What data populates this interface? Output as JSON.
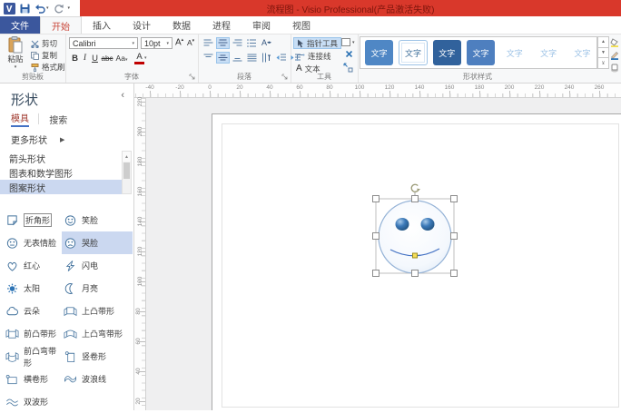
{
  "titlebar": {
    "title": "流程图 - Visio Professional(产品激活失败)",
    "quick_access_icons": [
      "visio-app-icon",
      "save-icon",
      "undo-icon",
      "redo-icon",
      "customize-qat-icon"
    ]
  },
  "tabs": {
    "file": "文件",
    "items": [
      "开始",
      "插入",
      "设计",
      "数据",
      "进程",
      "审阅",
      "视图"
    ],
    "selected": "开始"
  },
  "ribbon": {
    "clipboard": {
      "label": "剪贴板",
      "paste": "粘贴",
      "cut": "剪切",
      "copy": "复制",
      "format_painter": "格式刷"
    },
    "font": {
      "label": "字体",
      "family": "Calibri",
      "size": "10pt",
      "grow": "A",
      "shrink": "A",
      "bold": "B",
      "italic": "I",
      "underline": "U",
      "strike": "abc",
      "case": "Aa",
      "color": "A"
    },
    "paragraph": {
      "label": "段落",
      "letter_icon": "A"
    },
    "tools": {
      "label": "工具",
      "pointer": "指针工具",
      "connector": "连接线",
      "text": "文本",
      "text_letter": "A"
    },
    "shape_styles": {
      "label": "形状样式",
      "swatch_text": "文字"
    },
    "format_buttons": {
      "fill": "填充",
      "line": "线条",
      "effects": "效果"
    }
  },
  "panel": {
    "title": "形状",
    "collapse_icon": "chevron-left-icon",
    "tabs": [
      "模具",
      "搜索"
    ],
    "selected_tab": "模具",
    "more_shapes": "更多形状",
    "stencils": [
      "箭头形状",
      "图表和数学图形",
      "图案形状"
    ],
    "selected_stencil": "图案形状",
    "shapes": [
      {
        "label": "折角形",
        "icon": "folded-corner",
        "focused": true
      },
      {
        "label": "笑脸",
        "icon": "smiley-face"
      },
      {
        "label": "无表情脸",
        "icon": "neutral-face"
      },
      {
        "label": "哭脸",
        "icon": "sad-face",
        "selected": true
      },
      {
        "label": "红心",
        "icon": "heart"
      },
      {
        "label": "闪电",
        "icon": "lightning"
      },
      {
        "label": "太阳",
        "icon": "sun"
      },
      {
        "label": "月亮",
        "icon": "moon"
      },
      {
        "label": "云朵",
        "icon": "cloud"
      },
      {
        "label": "上凸带形",
        "icon": "ribbon-up"
      },
      {
        "label": "前凸带形",
        "icon": "ribbon-front"
      },
      {
        "label": "上凸弯带形",
        "icon": "curved-ribbon-up"
      },
      {
        "label": "前凸弯带形",
        "icon": "curved-ribbon-front"
      },
      {
        "label": "竖卷形",
        "icon": "vertical-scroll"
      },
      {
        "label": "横卷形",
        "icon": "horizontal-scroll"
      },
      {
        "label": "波浪线",
        "icon": "wave"
      },
      {
        "label": "双波形",
        "icon": "double-wave"
      }
    ]
  },
  "rulers": {
    "horizontal": [
      "-40",
      "-20",
      "0",
      "20",
      "40",
      "60",
      "80",
      "100",
      "120",
      "140",
      "160",
      "180",
      "200",
      "220",
      "240",
      "260"
    ],
    "vertical": [
      "220",
      "200",
      "180",
      "160",
      "140",
      "120",
      "100",
      "80",
      "60",
      "40",
      "20"
    ]
  },
  "canvas": {
    "selected_shape": "哭脸(笑脸形状)",
    "selection_handles": 8,
    "has_rotation_handle": true,
    "has_control_handle": true
  },
  "colors": {
    "titlebar_bg": "#D9382B",
    "titlebar_text": "#7E150C",
    "file_tab_bg": "#3B579D",
    "active_tab_text": "#C9473A",
    "ribbon_highlight": "#C8DEF5",
    "panel_selection": "#CBD8F0",
    "stencil_icon_blue": "#41719C",
    "shape_outline": "#95B3D7",
    "eye_blue": "#2E74B5",
    "smile_stroke": "#4472C4",
    "control_handle_yellow": "#F5DE5A"
  }
}
